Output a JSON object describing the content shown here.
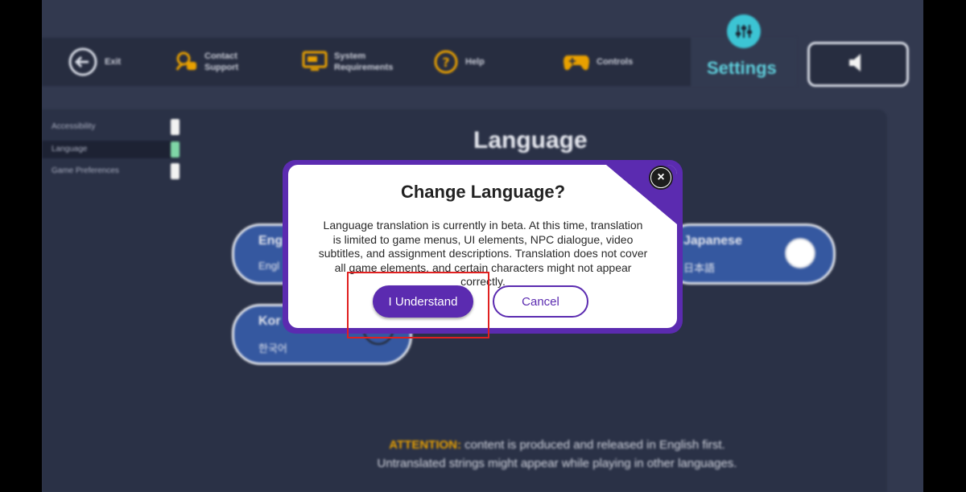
{
  "nav": {
    "exit": "Exit",
    "contact_support": "Contact Support",
    "system_requirements": "System Requirements",
    "help": "Help",
    "controls": "Controls",
    "settings": "Settings"
  },
  "sidebar": {
    "items": [
      {
        "label": "Accessibility"
      },
      {
        "label": "Language"
      },
      {
        "label": "Game Preferences"
      }
    ]
  },
  "language_panel": {
    "title": "Language",
    "cards": [
      {
        "name": "Eng",
        "native": "Engl"
      },
      {
        "name": "Japanese",
        "native": "日本語"
      },
      {
        "name": "Kor",
        "native": "한국어"
      }
    ]
  },
  "attention": {
    "prefix": "ATTENTION:",
    "line1": "content is produced and released in English first.",
    "line2": "Untranslated strings might appear while playing in other languages."
  },
  "dialog": {
    "title": "Change Language?",
    "body": "Language translation is currently in beta. At this time, translation is limited to game menus, UI elements, NPC dialogue, video subtitles, and assignment descriptions. Translation does not cover all game elements, and certain characters might not appear correctly.",
    "confirm_label": "I Understand",
    "cancel_label": "Cancel",
    "close_icon": "×"
  },
  "colors": {
    "accent_purple": "#5b2bb0",
    "settings_cyan": "#3cc4d4",
    "warning_orange": "#e8a000",
    "highlight_red": "#e02020"
  }
}
